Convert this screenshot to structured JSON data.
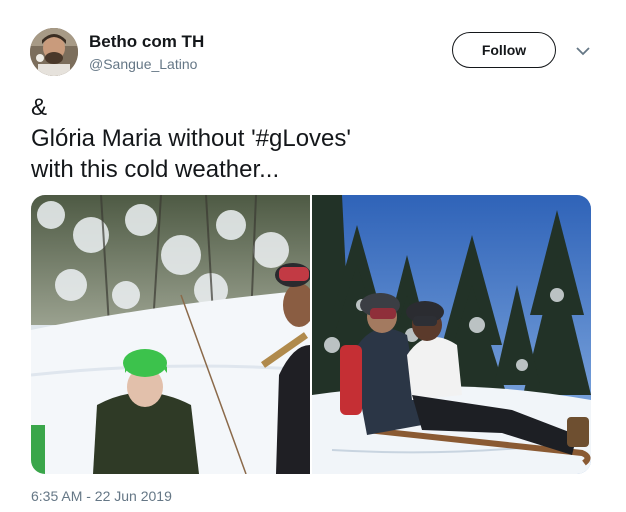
{
  "author": {
    "display_name": "Betho com TH",
    "handle": "@Sangue_Latino"
  },
  "actions": {
    "follow_label": "Follow"
  },
  "tweet": {
    "lines": [
      "&",
      "Glória Maria without '#gLoves'",
      "with this cold weather..."
    ]
  },
  "media": {
    "photos": [
      {
        "description_icon": "photo-snow-woman-green-helmet"
      },
      {
        "description_icon": "photo-sled-riders-forest"
      }
    ]
  },
  "meta": {
    "timestamp": "6:35 AM - 22 Jun 2019"
  },
  "colors": {
    "text": "#14171a",
    "secondary": "#657786",
    "border": "#14171a"
  }
}
